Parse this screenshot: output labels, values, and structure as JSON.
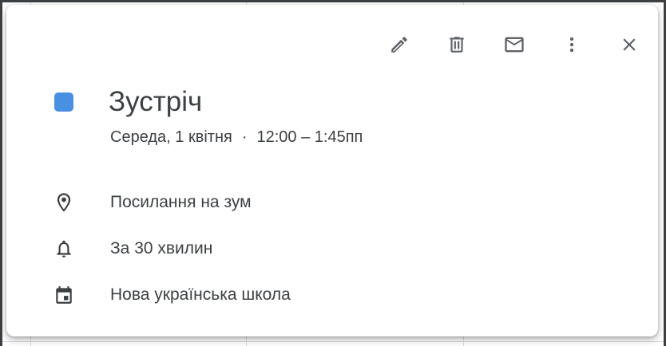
{
  "event": {
    "title": "Зустріч",
    "date": "Середа, 1 квітня",
    "separator": "·",
    "time": "12:00 – 1:45пп",
    "color": "#4a90e2"
  },
  "details": {
    "location": "Посилання на зум",
    "reminder": "За 30 хвилин",
    "calendar": "Нова українська школа"
  },
  "toolbar": {
    "icons": [
      "pencil-icon",
      "trash-icon",
      "mail-icon",
      "more-vert-icon",
      "close-icon"
    ]
  },
  "colors": {
    "icon": "#5f6368",
    "text": "#3c4043",
    "accent": "#4a90e2"
  }
}
